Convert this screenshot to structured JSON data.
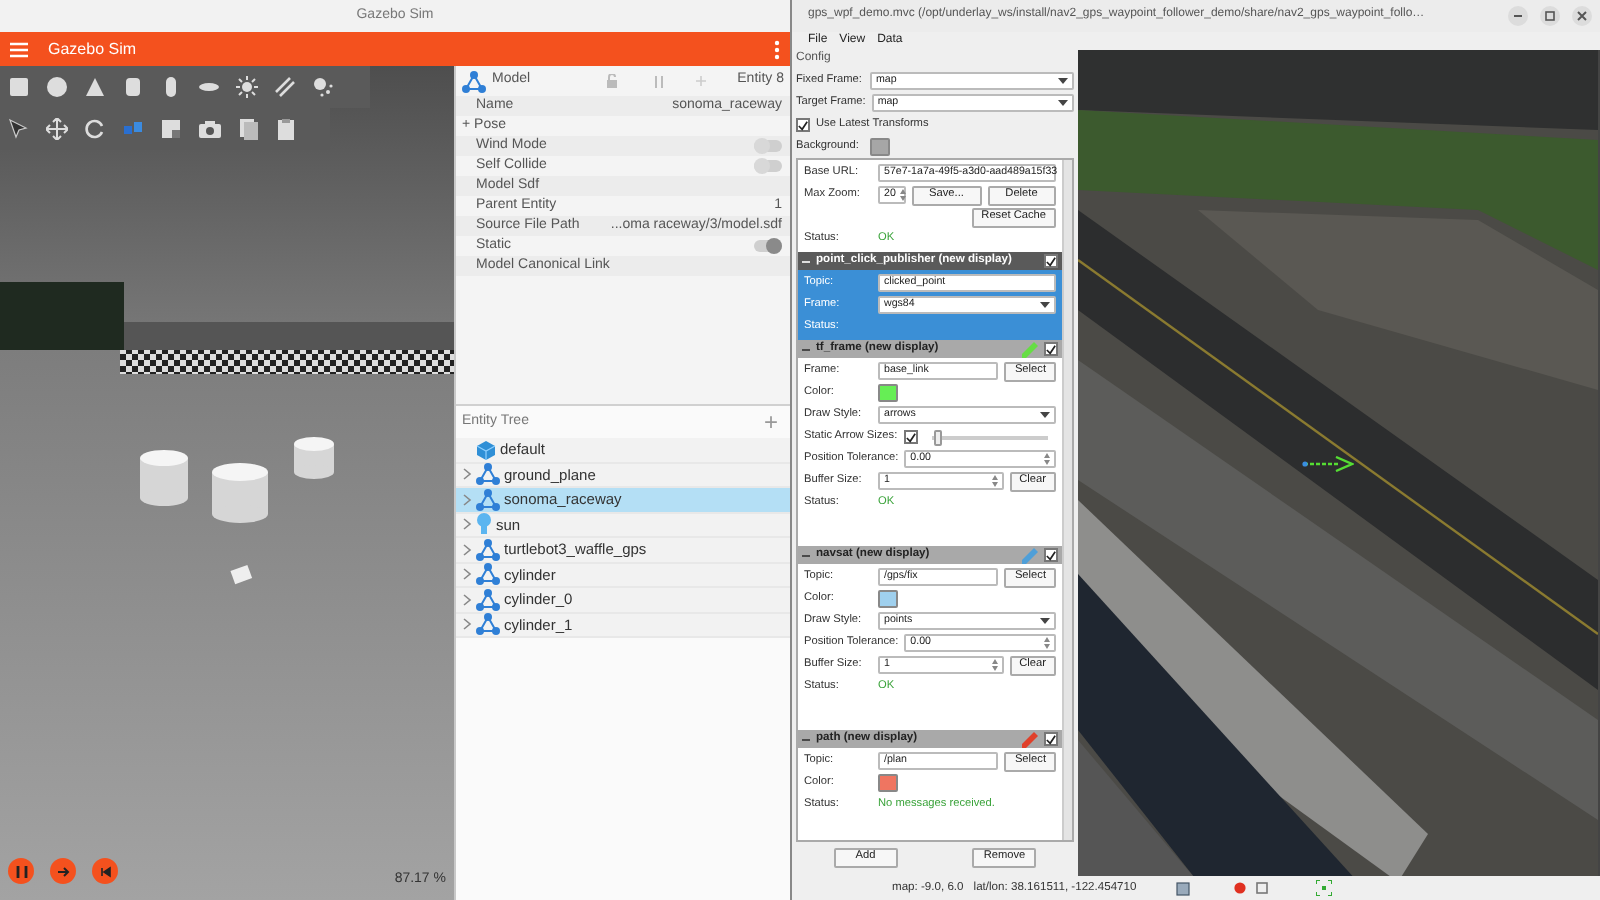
{
  "gazebo": {
    "title": "Gazebo Sim",
    "app_title": "Gazebo Sim",
    "rtf": "87.17 %",
    "inspector": {
      "type": "Model",
      "entity": "Entity 8",
      "rows": [
        {
          "kind": "value",
          "label": "Name",
          "value": "sonoma_raceway"
        },
        {
          "kind": "group",
          "label": "Pose",
          "symbol": "+"
        },
        {
          "kind": "toggle",
          "label": "Wind Mode",
          "on": false
        },
        {
          "kind": "toggle",
          "label": "Self Collide",
          "on": false
        },
        {
          "kind": "value",
          "label": "Model Sdf"
        },
        {
          "kind": "value",
          "label": "Parent Entity",
          "value": "1"
        },
        {
          "kind": "value",
          "label": "Source File Path",
          "value": "...oma raceway/3/model.sdf"
        },
        {
          "kind": "toggle",
          "label": "Static",
          "on": true
        },
        {
          "kind": "value",
          "label": "Model Canonical Link"
        }
      ]
    },
    "entity_tree": {
      "title": "Entity Tree",
      "add": "+",
      "items": [
        {
          "kind": "world",
          "label": "default",
          "expandable": false,
          "selected": false
        },
        {
          "kind": "model",
          "label": "ground_plane",
          "expandable": true,
          "selected": false
        },
        {
          "kind": "model",
          "label": "sonoma_raceway",
          "expandable": true,
          "selected": true
        },
        {
          "kind": "light",
          "label": "sun",
          "expandable": true,
          "selected": false
        },
        {
          "kind": "model",
          "label": "turtlebot3_waffle_gps",
          "expandable": true,
          "selected": false
        },
        {
          "kind": "model",
          "label": "cylinder",
          "expandable": true,
          "selected": false
        },
        {
          "kind": "model",
          "label": "cylinder_0",
          "expandable": true,
          "selected": false
        },
        {
          "kind": "model",
          "label": "cylinder_1",
          "expandable": true,
          "selected": false
        }
      ]
    }
  },
  "mapviz": {
    "title": "gps_wpf_demo.mvc (/opt/underlay_ws/install/nav2_gps_waypoint_follower_demo/share/nav2_gps_waypoint_follo…",
    "menu": [
      "File",
      "View",
      "Data"
    ],
    "config": {
      "title": "Config",
      "rows": [
        {
          "kind": "combo",
          "label": "Fixed Frame:",
          "value": "map"
        },
        {
          "kind": "combo",
          "label": "Target Frame:",
          "value": "map"
        },
        {
          "kind": "checkbox",
          "label": "Use Latest Transforms",
          "checked": true
        },
        {
          "kind": "color",
          "label": "Background:",
          "color": "#a6a6a6"
        }
      ],
      "displays": [
        {
          "selected": false,
          "rows": [
            {
              "kind": "text",
              "label": "Base URL:",
              "value": "57e7-1a7a-49f5-a3d0-aad489a15f33"
            },
            {
              "kind": "spin-buttons",
              "label": "Max Zoom:",
              "value": "20",
              "buttons": [
                "Save...",
                "Delete"
              ]
            },
            {
              "kind": "button",
              "label": "Reset Cache"
            },
            {
              "kind": "status",
              "label": "Status:",
              "value": "OK"
            }
          ]
        },
        {
          "name": "point_click_publisher (new display)",
          "visible": true,
          "selected": true,
          "rows": [
            {
              "kind": "text",
              "label": "Topic:",
              "value": "clicked_point"
            },
            {
              "kind": "combo",
              "label": "Frame:",
              "value": "wgs84"
            },
            {
              "kind": "status",
              "label": "Status:"
            }
          ]
        },
        {
          "name": "tf_frame (new display)",
          "visible": true,
          "selected": false,
          "color": "#66dd44",
          "rows": [
            {
              "kind": "text-button",
              "label": "Frame:",
              "value": "base_link",
              "button": "Select"
            },
            {
              "kind": "color",
              "label": "Color:",
              "color": "#66ee55"
            },
            {
              "kind": "combo",
              "label": "Draw Style:",
              "value": "arrows"
            },
            {
              "kind": "checkbox-slider",
              "label": "Static Arrow Sizes:",
              "checked": true,
              "level": 0.05
            },
            {
              "kind": "spin",
              "label": "Position Tolerance:",
              "value": "0.00"
            },
            {
              "kind": "spin-button",
              "label": "Buffer Size:",
              "value": "1",
              "button": "Clear"
            },
            {
              "kind": "status",
              "label": "Status:",
              "value": "OK"
            }
          ]
        },
        {
          "name": "navsat (new display)",
          "visible": true,
          "selected": false,
          "color": "#4f9fd8",
          "rows": [
            {
              "kind": "text-button",
              "label": "Topic:",
              "value": "/gps/fix",
              "button": "Select"
            },
            {
              "kind": "color",
              "label": "Color:",
              "color": "#9fd0ee"
            },
            {
              "kind": "combo",
              "label": "Draw Style:",
              "value": "points"
            },
            {
              "kind": "spin",
              "label": "Position Tolerance:",
              "value": "0.00"
            },
            {
              "kind": "spin-button",
              "label": "Buffer Size:",
              "value": "1",
              "button": "Clear"
            },
            {
              "kind": "status",
              "label": "Status:",
              "value": "OK"
            }
          ]
        },
        {
          "name": "path (new display)",
          "visible": true,
          "selected": false,
          "color": "#e0402a",
          "rows": [
            {
              "kind": "text-button",
              "label": "Topic:",
              "value": "/plan",
              "button": "Select"
            },
            {
              "kind": "color",
              "label": "Color:",
              "color": "#ef7561"
            },
            {
              "kind": "status",
              "label": "Status:",
              "value": "No messages received."
            }
          ]
        }
      ],
      "buttons": [
        "Add",
        "Remove"
      ]
    },
    "status_bar": {
      "position": "map: -9.0, 6.0",
      "lat_lon": "lat/lon: 38.161511, -122.454710"
    }
  }
}
